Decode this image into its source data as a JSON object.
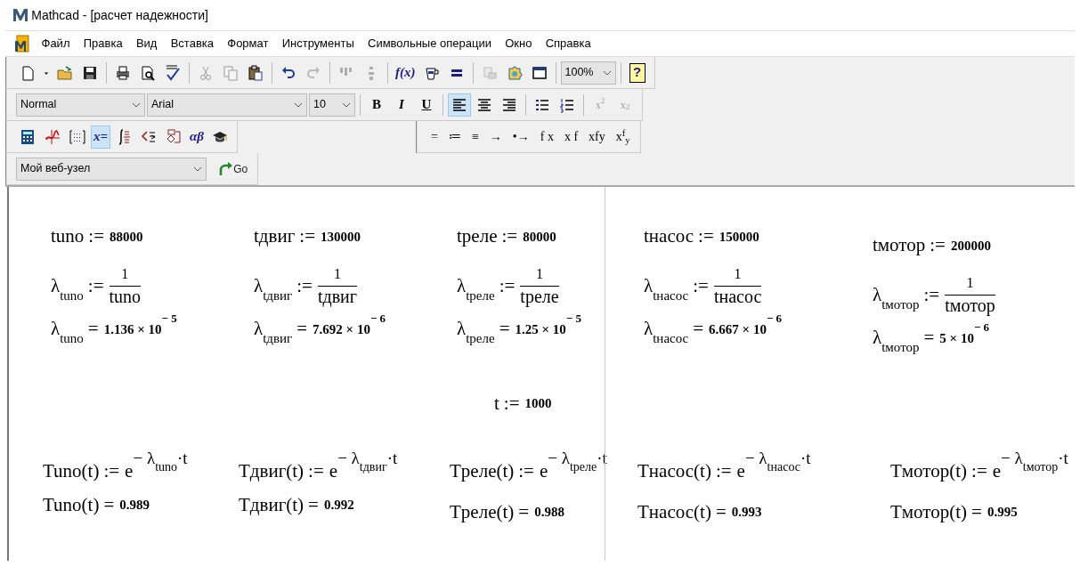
{
  "window": {
    "title": "Mathcad - [расчет надежности]"
  },
  "menu": [
    "Файл",
    "Правка",
    "Вид",
    "Вставка",
    "Формат",
    "Инструменты",
    "Символьные операции",
    "Окно",
    "Справка"
  ],
  "toolbars": {
    "standard": [
      {
        "kind": "new",
        "disabled": false
      },
      {
        "kind": "caret",
        "disabled": false
      },
      {
        "kind": "open",
        "disabled": false
      },
      {
        "kind": "save",
        "disabled": false
      },
      {
        "kind": "separator"
      },
      {
        "kind": "print",
        "disabled": false
      },
      {
        "kind": "preview",
        "disabled": false
      },
      {
        "kind": "spell",
        "disabled": false
      },
      {
        "kind": "separator"
      },
      {
        "kind": "cut",
        "disabled": true
      },
      {
        "kind": "copy",
        "disabled": true
      },
      {
        "kind": "paste",
        "disabled": false
      },
      {
        "kind": "separator"
      },
      {
        "kind": "undo",
        "disabled": false
      },
      {
        "kind": "redo",
        "disabled": true
      },
      {
        "kind": "separator"
      },
      {
        "kind": "align-across",
        "disabled": true
      },
      {
        "kind": "align-down",
        "disabled": true
      },
      {
        "kind": "separator"
      },
      {
        "kind": "function",
        "label": "f(x)",
        "disabled": false
      },
      {
        "kind": "unit",
        "disabled": false
      },
      {
        "kind": "calculate",
        "disabled": false
      },
      {
        "kind": "separator"
      },
      {
        "kind": "component",
        "disabled": true
      },
      {
        "kind": "resource",
        "disabled": false
      },
      {
        "kind": "window",
        "disabled": false
      },
      {
        "kind": "separator"
      },
      {
        "kind": "select",
        "value": "100%"
      },
      {
        "kind": "separator"
      },
      {
        "kind": "help",
        "label": "?",
        "disabled": false
      }
    ],
    "formatting": [
      {
        "kind": "select",
        "value": "Normal"
      },
      {
        "kind": "select",
        "value": "Arial"
      },
      {
        "kind": "select",
        "value": "10"
      },
      {
        "kind": "separator"
      },
      {
        "kind": "bold",
        "label": "B",
        "disabled": false,
        "pressed": false
      },
      {
        "kind": "italic",
        "label": "I",
        "disabled": false,
        "pressed": false
      },
      {
        "kind": "underline",
        "label": "U",
        "disabled": false,
        "pressed": false
      },
      {
        "kind": "separator"
      },
      {
        "kind": "align-left",
        "disabled": false,
        "pressed": true
      },
      {
        "kind": "align-center",
        "disabled": false,
        "pressed": false
      },
      {
        "kind": "align-right",
        "disabled": false,
        "pressed": false
      },
      {
        "kind": "separator"
      },
      {
        "kind": "bullets",
        "disabled": false,
        "pressed": false
      },
      {
        "kind": "numbering",
        "disabled": false,
        "pressed": false
      },
      {
        "kind": "separator"
      },
      {
        "kind": "superscript",
        "label": "x$^{2}$",
        "disabled": true,
        "pressed": false
      },
      {
        "kind": "subscript",
        "label": "x$_{2}$",
        "disabled": true,
        "pressed": false
      }
    ],
    "math": [
      {
        "kind": "calculator",
        "pressed": false
      },
      {
        "kind": "graph",
        "pressed": false
      },
      {
        "kind": "matrix",
        "pressed": false
      },
      {
        "kind": "evaluation",
        "label": "x=",
        "pressed": true
      },
      {
        "kind": "calculus",
        "pressed": false
      },
      {
        "kind": "boolean",
        "pressed": false
      },
      {
        "kind": "programming",
        "pressed": false
      },
      {
        "kind": "greek",
        "label": "αβ",
        "pressed": false
      },
      {
        "kind": "symbolic",
        "pressed": false
      }
    ],
    "evaluation": [
      "=",
      "≔",
      "≡",
      "→",
      "•→",
      "f x",
      "x f",
      "xfy",
      "x$^{f}$$_{y}$"
    ],
    "web": {
      "address": "Мой веб-узел",
      "go": "Go"
    }
  },
  "worksheet": {
    "columns": [
      {
        "definition": {
          "lhs": "tuno",
          "op": ":=",
          "value": "88000"
        },
        "rate": {
          "lhs": "λ$_{tuno}$",
          "op": ":=",
          "numerator": "1",
          "denominator": "tuno"
        },
        "rate_result": {
          "lhs": "λ$_{tuno}$",
          "op": "=",
          "value": "1.136 × 10$^{− 5}$"
        }
      },
      {
        "definition": {
          "lhs": "tдвиг",
          "op": ":=",
          "value": "130000"
        },
        "rate": {
          "lhs": "λ$_{tдвиг}$",
          "op": ":=",
          "numerator": "1",
          "denominator": "tдвиг"
        },
        "rate_result": {
          "lhs": "λ$_{tдвиг}$",
          "op": "=",
          "value": "7.692 × 10$^{− 6}$"
        }
      },
      {
        "definition": {
          "lhs": "tреле",
          "op": ":=",
          "value": "80000"
        },
        "rate": {
          "lhs": "λ$_{tреле}$",
          "op": ":=",
          "numerator": "1",
          "denominator": "tреле"
        },
        "rate_result": {
          "lhs": "λ$_{tреле}$",
          "op": "=",
          "value": "1.25 × 10$^{− 5}$"
        }
      },
      {
        "definition": {
          "lhs": "tнасос",
          "op": ":=",
          "value": "150000"
        },
        "rate": {
          "lhs": "λ$_{tнасос}$",
          "op": ":=",
          "numerator": "1",
          "denominator": "tнасос"
        },
        "rate_result": {
          "lhs": "λ$_{tнасос}$",
          "op": "=",
          "value": "6.667 × 10$^{− 6}$"
        }
      },
      {
        "definition": {
          "lhs": "tмотор",
          "op": ":=",
          "value": "200000"
        },
        "rate": {
          "lhs": "λ$_{tмотор}$",
          "op": ":=",
          "numerator": "1",
          "denominator": "tмотор"
        },
        "rate_result": {
          "lhs": "λ$_{tмотор}$",
          "op": "=",
          "value": "5 × 10$^{− 6}$"
        }
      }
    ],
    "time": {
      "lhs": "t",
      "op": ":=",
      "value": "1000"
    },
    "functions": [
      {
        "definition": {
          "lhs": "Tuno(t)",
          "op": ":=",
          "base": "e",
          "exponent": "− λ$_{tuno}$·t"
        },
        "result": {
          "lhs": "Tuno(t)",
          "op": "=",
          "value": "0.989"
        }
      },
      {
        "definition": {
          "lhs": "Tдвиг(t)",
          "op": ":=",
          "base": "e",
          "exponent": "− λ$_{tдвиг}$·t"
        },
        "result": {
          "lhs": "Tдвиг(t)",
          "op": "=",
          "value": "0.992"
        }
      },
      {
        "definition": {
          "lhs": "Tреле(t)",
          "op": ":=",
          "base": "e",
          "exponent": "− λ$_{tреле}$·t"
        },
        "result": {
          "lhs": "Tреле(t)",
          "op": "=",
          "value": "0.988"
        }
      },
      {
        "definition": {
          "lhs": "Tнасос(t)",
          "op": ":=",
          "base": "e",
          "exponent": "− λ$_{tнасос}$·t"
        },
        "result": {
          "lhs": "Tнасос(t)",
          "op": "=",
          "value": "0.993"
        }
      },
      {
        "definition": {
          "lhs": "Tмотор(t)",
          "op": ":=",
          "base": "e",
          "exponent": "− λ$_{tмотор}$·t"
        },
        "result": {
          "lhs": "Tмотор(t)",
          "op": "=",
          "value": "0.995"
        }
      }
    ]
  }
}
